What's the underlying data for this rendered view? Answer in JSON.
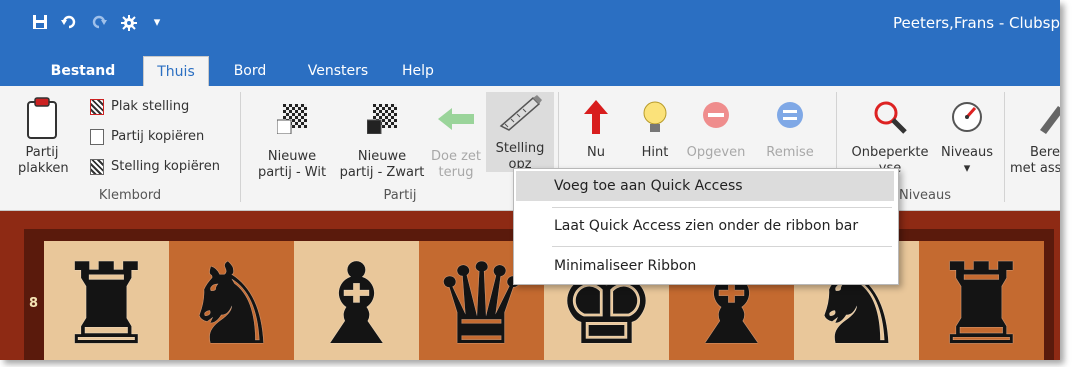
{
  "window": {
    "title": "Peeters,Frans - Clubsp",
    "quick_access": {
      "save": "save-icon",
      "undo": "undo-icon",
      "redo": "redo-icon",
      "engine": "engine-icon",
      "customize": "▾"
    }
  },
  "tabs": [
    "Bestand",
    "Thuis",
    "Bord",
    "Vensters",
    "Help"
  ],
  "active_tab": "Thuis",
  "ribbon": {
    "klembord": {
      "label": "Klembord",
      "paste_line1": "Partij",
      "paste_line2": "plakken",
      "items": [
        "Plak stelling",
        "Partij kopiëren",
        "Stelling kopiëren"
      ]
    },
    "partij": {
      "label": "Partij",
      "nieuwe_wit_line1": "Nieuwe",
      "nieuwe_wit_line2": "partij - Wit",
      "nieuwe_zwart_line1": "Nieuwe",
      "nieuwe_zwart_line2": "partij - Zwart",
      "doe_zet_line1": "Doe zet",
      "doe_zet_line2": "terug",
      "stelling_line1": "Stelling",
      "stelling_line2": "opz"
    },
    "spel": {
      "nu_line1": "Nu",
      "hint": "Hint",
      "opgeven": "Opgeven",
      "remise": "Remise"
    },
    "niveaus": {
      "label": "Niveaus",
      "onbeperkte_line1": "Onbeperkte",
      "onbeperkte_line2": "yse",
      "niveaus": "Niveaus",
      "arrow": "▾"
    },
    "bereken": {
      "line1": "Berek",
      "line2": "met ass"
    }
  },
  "board": {
    "rank_label": "8",
    "pieces": [
      "♜",
      "♞",
      "♝",
      "♛",
      "♚",
      "♝",
      "♞",
      "♜"
    ]
  },
  "context_menu": {
    "items": [
      "Voeg toe aan Quick Access",
      "Laat Quick Access zien onder de ribbon bar",
      "Minimaliseer Ribbon"
    ],
    "highlighted": 0
  },
  "colors": {
    "titlebar": "#2b6fc2",
    "ribbon": "#f4f4f4",
    "board_border": "#8e2a14",
    "light_square": "#e9c79a",
    "dark_square": "#c46a30"
  }
}
